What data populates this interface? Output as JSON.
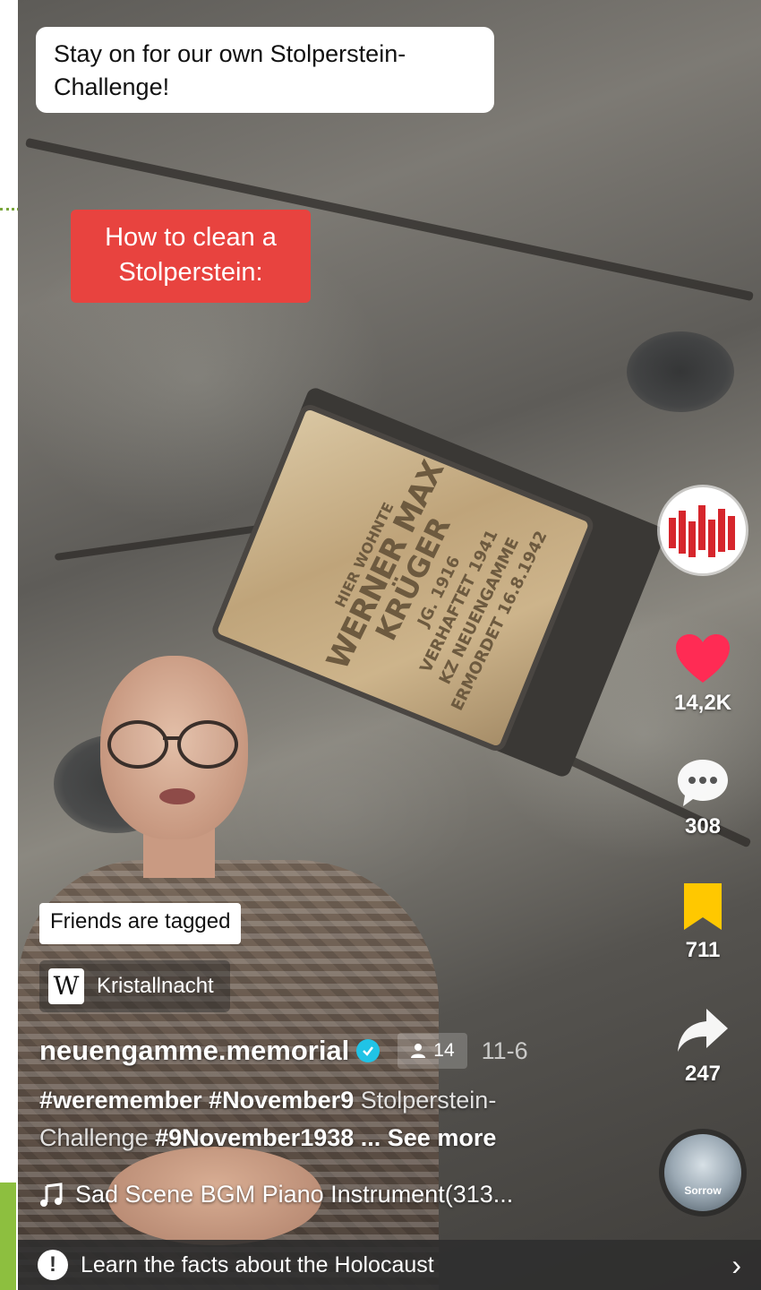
{
  "video": {
    "caption_top": "Stay on for our own Stolperstein-Challenge!",
    "caption_red": "How to clean a Stolperstein:",
    "stone": {
      "line1": "HIER WOHNTE",
      "line2": "WERNER MAX",
      "line3": "KRÜGER",
      "line4": "JG. 1916",
      "line5": "VERHAFTET 1941",
      "line6": "KZ NEUENGAMME",
      "line7": "ERMORDET 16.8.1942"
    }
  },
  "actions": {
    "likes": "14,2K",
    "comments": "308",
    "favorites": "711",
    "shares": "247"
  },
  "tags": {
    "friends": "Friends are tagged",
    "wiki": "Kristallnacht"
  },
  "post": {
    "username": "neuengamme.memorial",
    "friends_count": "14",
    "date": "11-6",
    "hashtag1": "#weremember",
    "hashtag2": "#November9",
    "text1": "Stolperstein-",
    "text2": "Challenge",
    "hashtag3": "#9November1938",
    "see_more": "... See more",
    "music": "Sad Scene BGM Piano Instrument(313..."
  },
  "disc": {
    "label": "Sorrow"
  },
  "facts_bar": {
    "text": "Learn the facts about the Holocaust"
  },
  "colors": {
    "like": "#ff2b54",
    "favorite": "#ffc800",
    "red_caption": "#e8433f",
    "verified": "#20c3e6"
  },
  "icons": [
    "music-note-icon",
    "heart-icon",
    "comment-icon",
    "bookmark-icon",
    "share-icon",
    "info-icon",
    "chevron-right-icon",
    "wikipedia-icon",
    "person-icon",
    "verified-icon"
  ]
}
